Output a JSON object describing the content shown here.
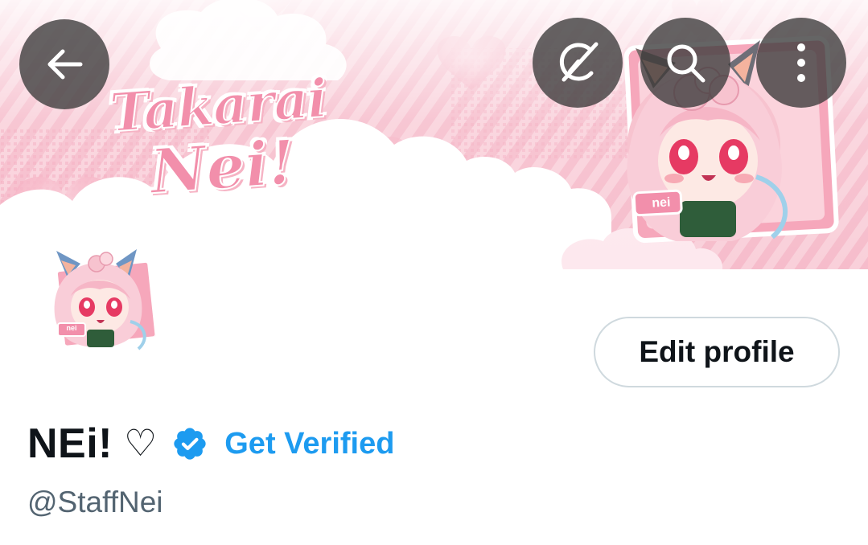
{
  "header": {
    "back_icon": "arrow-left-icon",
    "grok_icon": "grok-icon",
    "search_icon": "search-icon",
    "more_icon": "more-vertical-icon"
  },
  "banner": {
    "logo_line1": "Takarai",
    "logo_line2": "Nei!",
    "sticker_label": "nei"
  },
  "avatar": {
    "sticker_label": "nei"
  },
  "profile": {
    "edit_button_label": "Edit profile",
    "display_name": "NEi!",
    "name_symbol": "♡",
    "verified_icon": "verified-badge-icon",
    "get_verified_label": "Get Verified",
    "handle": "@StaffNei"
  },
  "colors": {
    "accent": "#1d9bf0",
    "text_primary": "#0f1419",
    "text_secondary": "#536471",
    "button_border": "#cfd9de",
    "banner_pink": "#f7c5d2",
    "logo_pink": "#f28fab"
  }
}
